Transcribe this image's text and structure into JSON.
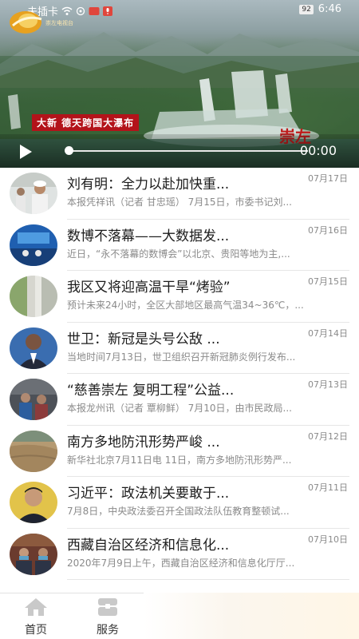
{
  "status_bar": {
    "carrier": "未插卡",
    "battery": "92",
    "time": "6:46"
  },
  "video": {
    "logo_text": "崇左电视台",
    "caption": "大新 德天跨国大瀑布",
    "watermark": "崇左",
    "time": "00:00",
    "progress": 0.0
  },
  "news": [
    {
      "title": "刘有明：全力以赴加快重...",
      "date": "07月17日",
      "summary": "本报凭祥讯（记者 甘忠瑶） 7月15日，市委书记刘..."
    },
    {
      "title": "数博不落幕——大数据发...",
      "date": "07月16日",
      "summary": "近日，“永不落幕的数博会”以北京、贵阳等地为主,..."
    },
    {
      "title": "我区又将迎高温干旱“烤验”",
      "date": "07月15日",
      "summary": "预计未来24小时，全区大部地区最高气温34~36℃，..."
    },
    {
      "title": "世卫：新冠是头号公敌 ...",
      "date": "07月14日",
      "summary": "当地时间7月13日，世卫组织召开新冠肺炎例行发布..."
    },
    {
      "title": "“慈善崇左 复明工程”公益...",
      "date": "07月13日",
      "summary": "本报龙州讯（记者 覃柳鲜） 7月10日，由市民政局..."
    },
    {
      "title": "南方多地防汛形势严峻 ...",
      "date": "07月12日",
      "summary": "新华社北京7月11日电 11日，南方多地防汛形势严..."
    },
    {
      "title": "习近平：政法机关要敢于...",
      "date": "07月11日",
      "summary": "7月8日，中央政法委召开全国政法队伍教育整顿试..."
    },
    {
      "title": "西藏自治区经济和信息化...",
      "date": "07月10日",
      "summary": "2020年7月9日上午，西藏自治区经济和信息化厅厅..."
    }
  ],
  "nav": {
    "home": "首页",
    "service": "服务"
  }
}
